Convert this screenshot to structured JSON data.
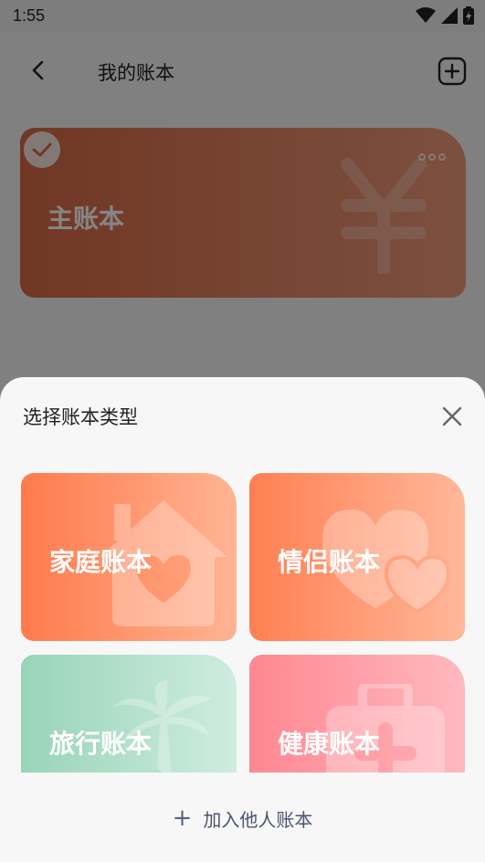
{
  "status_bar": {
    "time": "1:55",
    "icons": [
      "wifi-icon",
      "signal-icon",
      "battery-icon"
    ]
  },
  "header": {
    "title": "我的账本",
    "back_icon": "chevron-left-icon",
    "add_icon": "plus-square-icon"
  },
  "main_book": {
    "label": "主账本",
    "selected": true,
    "icon": "yen-icon",
    "more_icon": "more-dots-icon"
  },
  "sheet": {
    "title": "选择账本类型",
    "close_icon": "close-icon",
    "types": [
      {
        "label": "家庭账本",
        "icon": "house-heart-icon",
        "color_from": "#ff7a4c",
        "color_to": "#ffb493"
      },
      {
        "label": "情侣账本",
        "icon": "hearts-icon",
        "color_from": "#ff7f52",
        "color_to": "#ffb89a"
      },
      {
        "label": "旅行账本",
        "icon": "palm-tree-icon",
        "color_from": "#98d4b8",
        "color_to": "#cfece0"
      },
      {
        "label": "健康账本",
        "icon": "medical-kit-icon",
        "color_from": "#ff8791",
        "color_to": "#ffb9bf"
      }
    ],
    "join": {
      "label": "加入他人账本",
      "icon": "plus-icon"
    }
  }
}
